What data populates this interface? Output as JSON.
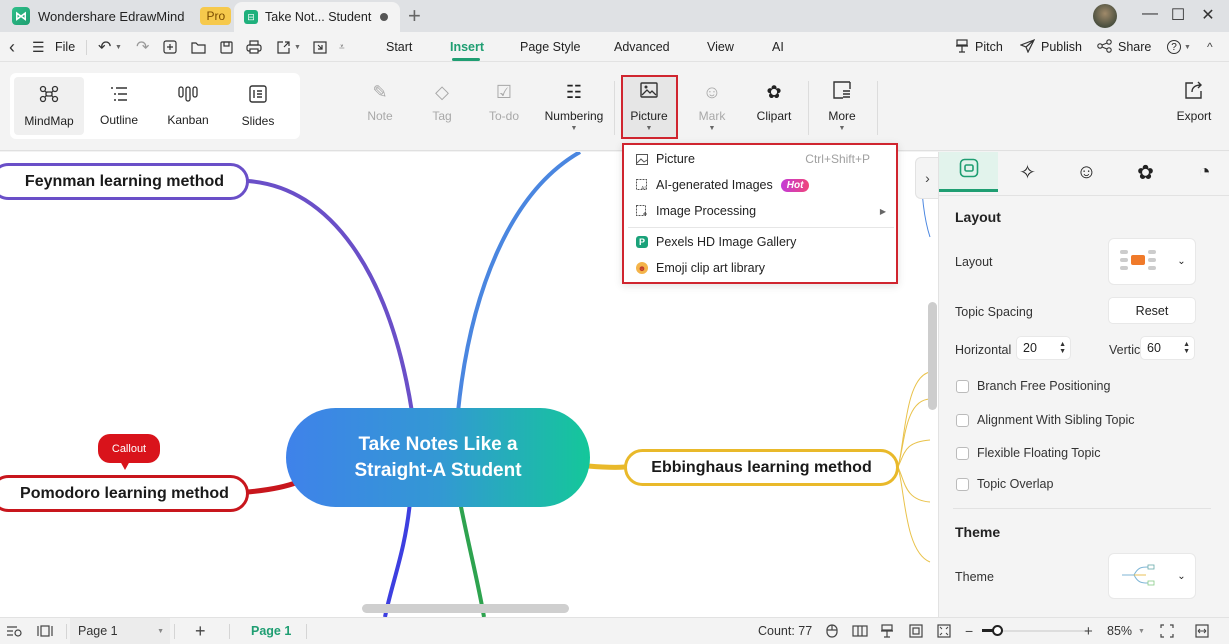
{
  "titlebar": {
    "app_name": "Wondershare EdrawMind",
    "pro_badge": "Pro",
    "doc_tab": "Take Not... Student",
    "new_tab": "+",
    "minimize": "—",
    "maximize": "☐",
    "close": "✕"
  },
  "menubar": {
    "back": "‹",
    "menu": "☰",
    "file": "File",
    "undo": "↶",
    "redo": "↷",
    "tabs": [
      "Start",
      "Insert",
      "Page Style",
      "Advanced",
      "View",
      "AI"
    ],
    "active_tab": "Insert",
    "pitch": "Pitch",
    "publish": "Publish",
    "share": "Share",
    "help": "?",
    "collapse": "^"
  },
  "toolbar": {
    "views": [
      {
        "label": "MindMap",
        "icon": "mindmap-icon",
        "active": true
      },
      {
        "label": "Outline",
        "icon": "outline-icon"
      },
      {
        "label": "Kanban",
        "icon": "kanban-icon"
      },
      {
        "label": "Slides",
        "icon": "slides-icon"
      }
    ],
    "note": "Note",
    "tag": "Tag",
    "todo": "To-do",
    "numbering": "Numbering",
    "picture": "Picture",
    "mark": "Mark",
    "clipart": "Clipart",
    "more": "More",
    "export": "Export"
  },
  "picture_menu": {
    "items": [
      {
        "label": "Picture",
        "shortcut": "Ctrl+Shift+P",
        "icon": "picture-icon"
      },
      {
        "label": "AI-generated Images",
        "badge": "Hot",
        "icon": "ai-image-icon"
      },
      {
        "label": "Image Processing",
        "has_submenu": true,
        "icon": "image-processing-icon"
      },
      {
        "label": "Pexels HD Image Gallery",
        "icon": "pexels-icon"
      },
      {
        "label": "Emoji clip art library",
        "icon": "emoji-icon"
      }
    ]
  },
  "mindmap": {
    "central": "Take Notes Like a Straight-A Student",
    "central_line1": "Take Notes Like a",
    "central_line2": "Straight-A Student",
    "topics": [
      {
        "label": "Feynman learning method",
        "color": "#6a4fc8"
      },
      {
        "label": "Pomodoro learning method",
        "color": "#c8161d"
      },
      {
        "label": "Ebbinghaus learning method",
        "color": "#e9b92a"
      }
    ],
    "callout": "Callout",
    "branch_colors": {
      "blue": "#4a86e0",
      "indigo": "#3d3fe0",
      "green": "#2ea34f",
      "purple": "#6a4fc8",
      "red": "#c8161d",
      "yellow": "#e9b92a"
    }
  },
  "panel": {
    "tabs": [
      "layout-tab",
      "ai-style-tab",
      "mark-tab",
      "clipart-tab",
      "history-tab"
    ],
    "layout_heading": "Layout",
    "layout_label": "Layout",
    "topic_spacing_label": "Topic Spacing",
    "reset": "Reset",
    "horizontal_label": "Horizontal",
    "horizontal_value": "20",
    "vertical_label": "Vertical",
    "vertical_value": "60",
    "checks": [
      {
        "label": "Branch Free Positioning",
        "checked": false
      },
      {
        "label": "Alignment With Sibling Topic",
        "checked": false
      },
      {
        "label": "Flexible Floating Topic",
        "checked": false
      },
      {
        "label": "Topic Overlap",
        "checked": false
      }
    ],
    "theme_heading": "Theme",
    "theme_label": "Theme"
  },
  "statusbar": {
    "page_select": "Page 1",
    "add_page": "+",
    "active_page": "Page 1",
    "count": "Count: 77",
    "zoom_minus": "−",
    "zoom_plus": "+",
    "zoom_level": "85%",
    "zoom_fraction": 0.15
  }
}
